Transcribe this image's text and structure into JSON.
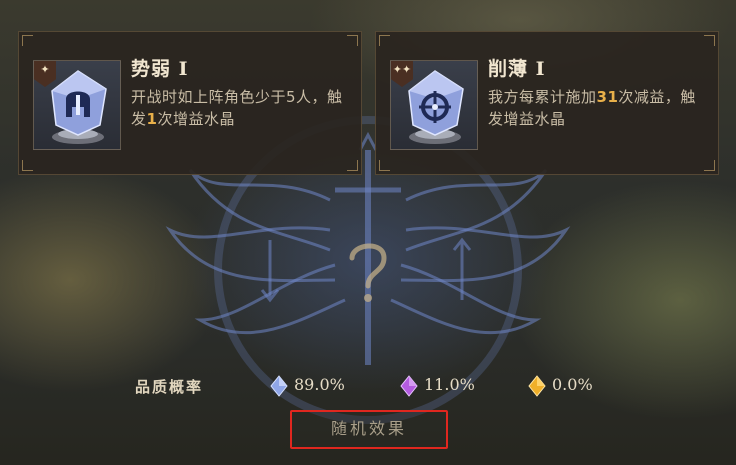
{
  "cards": [
    {
      "rank_symbol": "✦",
      "icon": "helmet-crystal-icon",
      "title": "势弱 I",
      "desc_pre": "开战时如上阵角色少于5人，触发",
      "desc_highlight": "1",
      "desc_post": "次增益水晶"
    },
    {
      "rank_symbol": "✦✦",
      "icon": "crosshair-crystal-icon",
      "title": "削薄 I",
      "desc_pre": "我方每累计施加",
      "desc_highlight": "31",
      "desc_post": "次减益，触发增益水晶"
    }
  ],
  "quality": {
    "label": "品质概率",
    "items": [
      {
        "icon": "blue-gem-icon",
        "color": "#8fa6e8",
        "value": "89.0%"
      },
      {
        "icon": "purple-gem-icon",
        "color": "#b45be0",
        "value": "11.0%"
      },
      {
        "icon": "gold-gem-icon",
        "color": "#f0b02a",
        "value": "0.0%"
      }
    ]
  },
  "random_button": {
    "label": "随机效果"
  },
  "colors": {
    "highlight": "#e8b04a",
    "button_border": "#e0271f"
  }
}
